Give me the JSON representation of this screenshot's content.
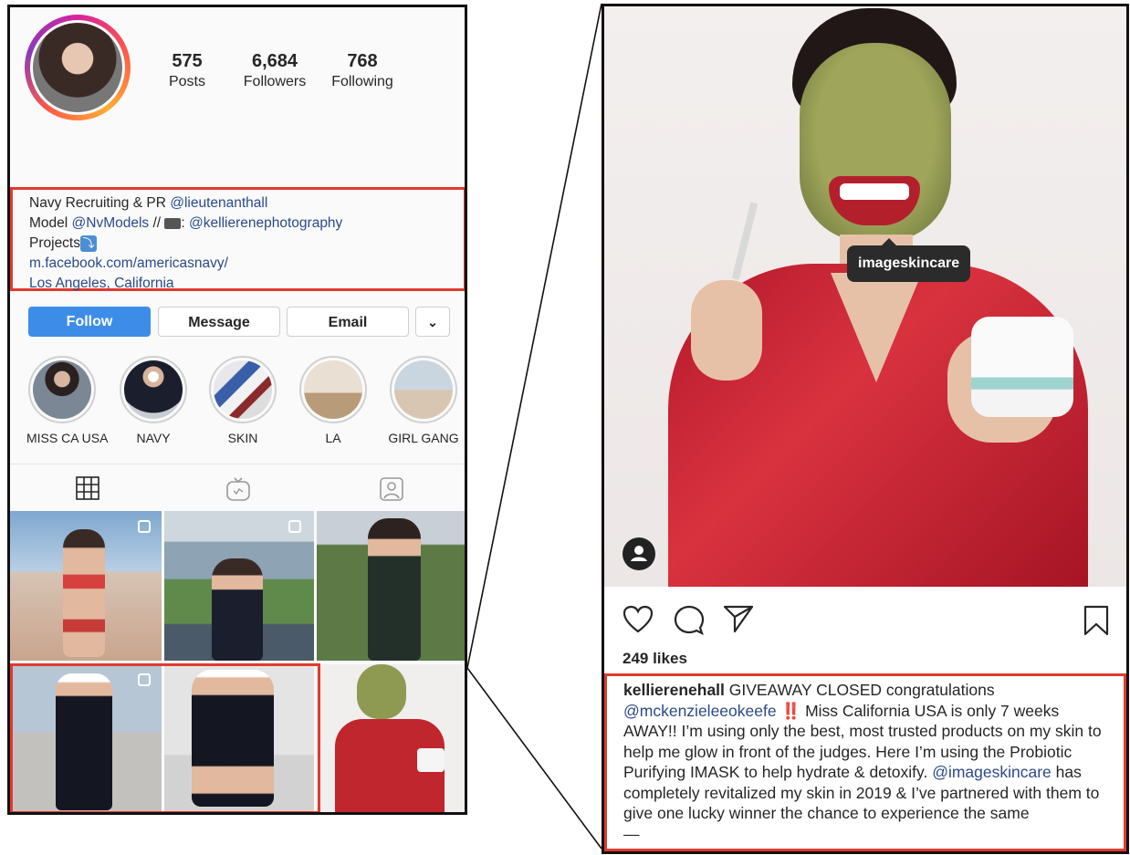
{
  "profile": {
    "stats": [
      {
        "num": "575",
        "label": "Posts"
      },
      {
        "num": "6,684",
        "label": "Followers"
      },
      {
        "num": "768",
        "label": "Following"
      }
    ],
    "bio": {
      "line1_text": "Navy Recruiting & PR ",
      "line1_link": "@lieutenanthall",
      "line2_text": "Model ",
      "line2_link1": "@NvModels",
      "line2_mid": " // ",
      "line2_colon": ": ",
      "line2_link2": "@kellierenephotography",
      "line3_text": "Projects",
      "line3_badge": "⤵",
      "line4_link": "m.facebook.com/americasnavy/",
      "line5_link": "Los Angeles, California"
    },
    "buttons": {
      "follow": "Follow",
      "message": "Message",
      "email": "Email",
      "more": "⌄"
    },
    "highlights": [
      "MISS CA USA",
      "NAVY",
      "SKIN",
      "LA",
      "GIRL GANG"
    ],
    "tabs": [
      "grid-icon",
      "igtv-icon",
      "tagged-icon"
    ],
    "colors": {
      "accent": "#3d8de8",
      "highlight_box": "#e03a2f",
      "link": "#2b4a8a"
    }
  },
  "post": {
    "tag": "imageskincare",
    "likes": "249 likes",
    "caption": {
      "username": "kellierenehall",
      "t1": " GIVEAWAY CLOSED congratulations ",
      "m1": "@mckenzieleeokeefe",
      "excl": " ‼️",
      "t2": " Miss California USA is only 7 weeks AWAY!! I’m using only the best, most trusted products on my skin to help me glow in front of the judges. Here I’m using the Probiotic Purifying IMASK to help hydrate & detoxify. ",
      "m2": "@imageskincare",
      "t3": " has completely revitalized my skin in 2019 & I’ve partnered with them to give one lucky winner the chance to experience the same",
      "t4": "—"
    }
  }
}
